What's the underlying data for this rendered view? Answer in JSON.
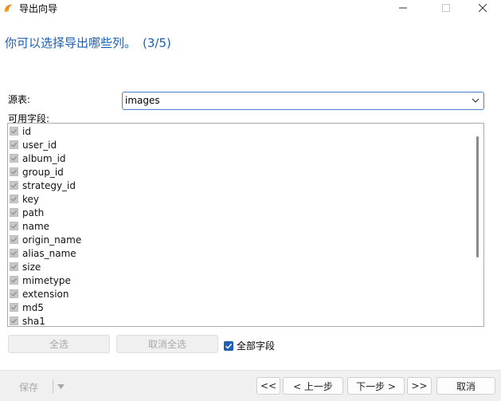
{
  "window": {
    "title": "导出向导"
  },
  "heading": {
    "text": "你可以选择导出哪些列。",
    "step": "(3/5)"
  },
  "source": {
    "label": "源表:",
    "value": "images"
  },
  "fields": {
    "label": "可用字段:",
    "items": [
      "id",
      "user_id",
      "album_id",
      "group_id",
      "strategy_id",
      "key",
      "path",
      "name",
      "origin_name",
      "alias_name",
      "size",
      "mimetype",
      "extension",
      "md5",
      "sha1"
    ]
  },
  "buttons": {
    "select_all": "全选",
    "deselect_all": "取消全选",
    "all_fields": "全部字段",
    "save": "保存",
    "first": "<<",
    "prev": "< 上一步",
    "next": "下一步 >",
    "last": ">>",
    "cancel": "取消"
  },
  "colors": {
    "accent": "#1f5fb4",
    "heading": "#1a5fb4"
  }
}
